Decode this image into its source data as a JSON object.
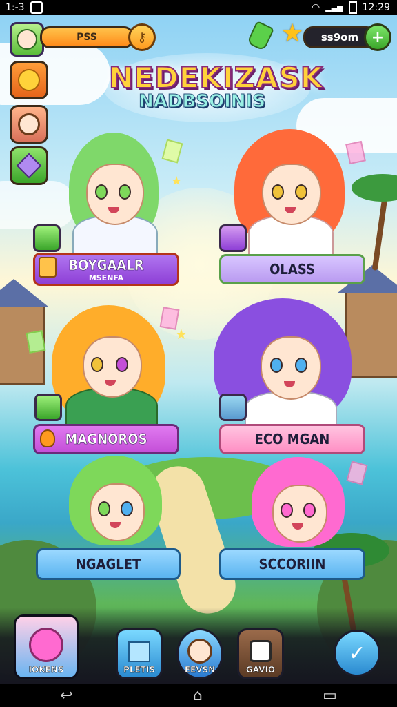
{
  "status_bar": {
    "left_text": "1:-3",
    "time": "12:29"
  },
  "hud": {
    "player_bar_value": "PSS",
    "currency_value": "ss9om",
    "add_label": "+"
  },
  "title": {
    "main": "NEDEKIZASK",
    "sub": "NADBSOINIS"
  },
  "characters": [
    {
      "name": "BOYGAALR",
      "subtitle": "MSENFA",
      "plate_color": "#8e3fd6",
      "hair_color": "#7fd86a"
    },
    {
      "name": "OLASS",
      "subtitle": "",
      "plate_color": "#b99af0",
      "hair_color": "#ff6a3a"
    },
    {
      "name": "MAGNOROS",
      "subtitle": "",
      "plate_color": "#c44fd8",
      "hair_color": "#ffad2a"
    },
    {
      "name": "ECO MGAN",
      "subtitle": "",
      "plate_color": "#ff8fc4",
      "hair_color": "#8a4fe0"
    },
    {
      "name": "NGAGLET",
      "subtitle": "",
      "plate_color": "#5ab4f0",
      "hair_color": "#7ed85a"
    },
    {
      "name": "SCCORIIN",
      "subtitle": "",
      "plate_color": "#5ab4f0",
      "hair_color": "#ff6ad0"
    }
  ],
  "bottom_nav": [
    {
      "label": "IOKENS"
    },
    {
      "label": "PLETIS"
    },
    {
      "label": "EEVSN"
    },
    {
      "label": "GAVIO"
    },
    {
      "label": ""
    }
  ],
  "system_nav": {
    "back": "↩",
    "home": "⌂",
    "recents": "▭"
  },
  "colors": {
    "accent_orange": "#ff9a1f",
    "accent_green": "#5bd04a",
    "title_yellow": "#ffd23a"
  }
}
